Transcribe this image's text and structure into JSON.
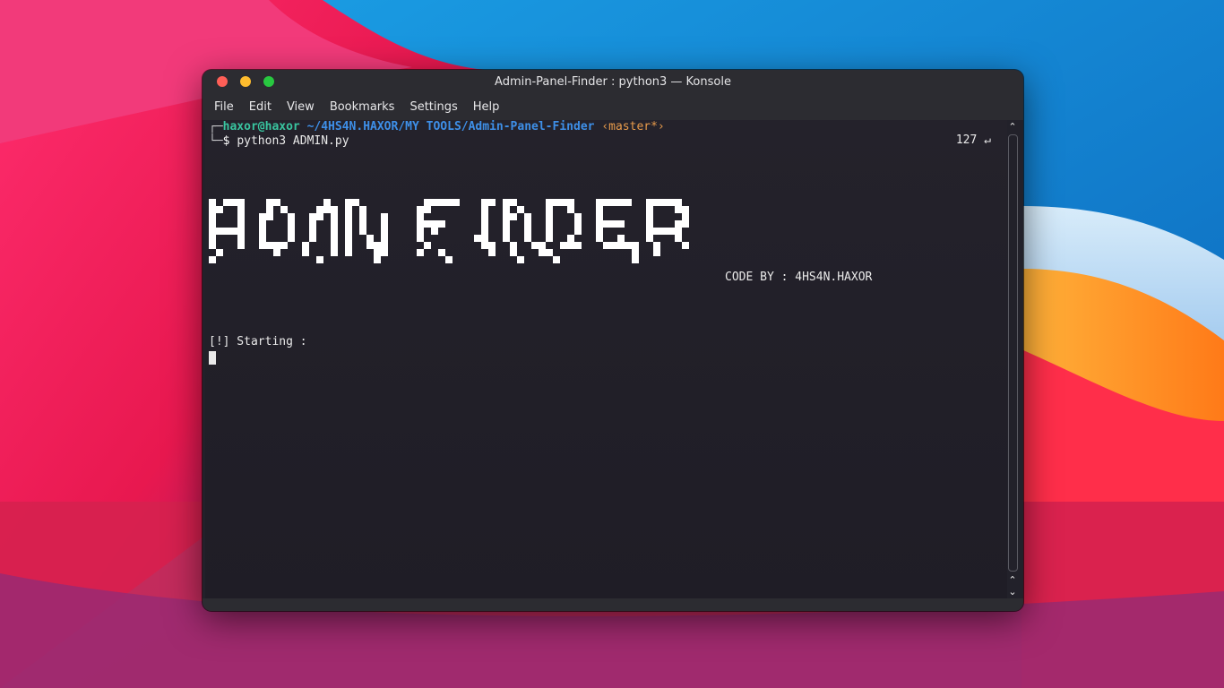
{
  "window": {
    "title": "Admin-Panel-Finder : python3 — Konsole"
  },
  "menu": {
    "items": [
      "File",
      "Edit",
      "View",
      "Bookmarks",
      "Settings",
      "Help"
    ]
  },
  "terminal": {
    "prompt_user": "haxor@haxor",
    "prompt_path": "~/4HS4N.HAXOR/MY TOOLS/Admin-Panel-Finder",
    "prompt_branch": "‹master*›",
    "prompt_symbol": "$",
    "command": "python3 ADMIN.py",
    "exit_status": "127 ↵",
    "banner_text": "ADMIN FINDER",
    "credit": "CODE BY : 4HS4N.HAXOR",
    "status_line": "[!] Starting :"
  },
  "colors": {
    "user": "#39c5a0",
    "path": "#3e8fe8",
    "branch": "#e89b4b",
    "terminal_bg": "#22212a",
    "close": "#ff5f57",
    "minimize": "#febc2e",
    "maximize": "#28c840"
  },
  "icons": {
    "scroll_up": "chevron-up-icon",
    "scroll_down": "chevron-down-icon"
  }
}
